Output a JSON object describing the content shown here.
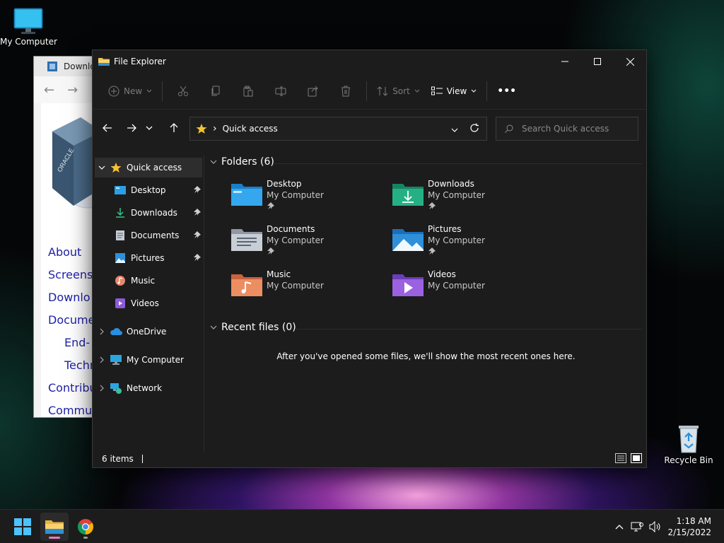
{
  "desktop": {
    "icons": [
      {
        "label": "My Computer"
      },
      {
        "label": "Recycle Bin"
      }
    ]
  },
  "background_window": {
    "title": "Downlo",
    "links": [
      "About",
      "Screens",
      "Downlo",
      "Docume",
      "End-",
      "Techn",
      "Contribu",
      "Commu"
    ]
  },
  "explorer": {
    "title": "File Explorer",
    "toolbar": {
      "new_label": "New",
      "sort_label": "Sort",
      "view_label": "View",
      "more_label": "•••"
    },
    "address": {
      "location": "Quick access",
      "separator": "›"
    },
    "search": {
      "placeholder": "Search Quick access"
    },
    "sidebar": {
      "quick_access": "Quick access",
      "items": [
        {
          "label": "Desktop"
        },
        {
          "label": "Downloads"
        },
        {
          "label": "Documents"
        },
        {
          "label": "Pictures"
        },
        {
          "label": "Music"
        },
        {
          "label": "Videos"
        }
      ],
      "onedrive": "OneDrive",
      "my_computer": "My Computer",
      "network": "Network"
    },
    "folders_header": "Folders (6)",
    "folders": [
      {
        "name": "Desktop",
        "location": "My Computer"
      },
      {
        "name": "Downloads",
        "location": "My Computer"
      },
      {
        "name": "Documents",
        "location": "My Computer"
      },
      {
        "name": "Pictures",
        "location": "My Computer"
      },
      {
        "name": "Music",
        "location": "My Computer"
      },
      {
        "name": "Videos",
        "location": "My Computer"
      }
    ],
    "recent_header": "Recent files (0)",
    "recent_empty": "After you've opened some files, we'll show the most recent ones here.",
    "status": {
      "items": "6 items"
    }
  },
  "taskbar": {
    "clock_time": "1:18 AM",
    "clock_date": "2/15/2022"
  },
  "colors": {
    "accent": "#60cdff",
    "folder_blue": "#3aa0e8",
    "downloads_green": "#22a57a",
    "music_orange": "#e98a5c",
    "videos_purple": "#8e5ad8",
    "chrome_red": "#db4437"
  }
}
